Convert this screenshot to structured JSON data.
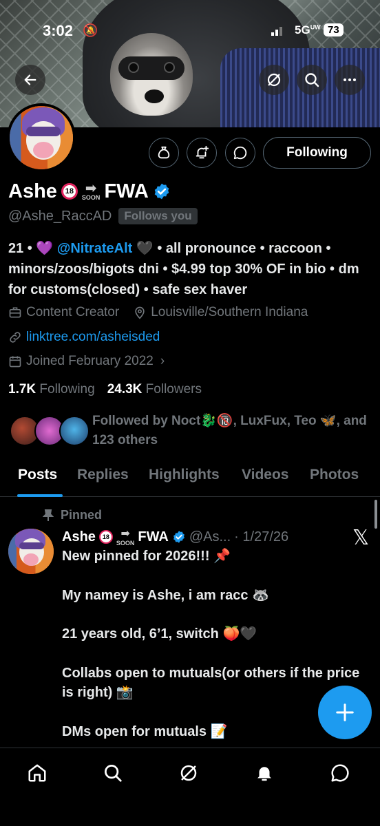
{
  "status_bar": {
    "time": "3:02",
    "network": "5G",
    "network_sub": "UW",
    "battery": "73"
  },
  "header": {
    "back_icon": "arrow-left-icon",
    "grok_icon": "grok-icon",
    "search_icon": "search-icon",
    "more_icon": "more-icon"
  },
  "profile": {
    "name": "Ashe",
    "name_badge": "18",
    "soon_label": "SOON",
    "name_suffix": "FWA",
    "handle": "@Ashe_RaccAD",
    "follows_you": "Follows you",
    "following_button": "Following",
    "bio": {
      "lead": "21 • 💜 ",
      "mention": "@NitrateAlt",
      "rest": " 🖤 • all pronounce • raccoon • minors/zoos/bigots dni • $4.99 top 30% OF in bio • dm for customs(closed) • safe sex haver"
    },
    "category": "Content Creator",
    "location": "Louisville/Southern Indiana",
    "link": "linktree.com/asheisded",
    "joined": "Joined February 2022",
    "following_count": "1.7K",
    "following_label": "Following",
    "followers_count": "24.3K",
    "followers_label": "Followers",
    "followed_by": "Followed by Noct🐉🔞, LuxFux, Teo 🦋, and 123 others"
  },
  "tabs": [
    "Posts",
    "Replies",
    "Highlights",
    "Videos",
    "Photos"
  ],
  "post": {
    "pinned_label": "Pinned",
    "author": "Ashe",
    "author_suffix": "FWA",
    "handle": "@As...",
    "date": "· 1/27/26",
    "lines": [
      "New pinned for 2026!!! 📌",
      "",
      "My namey is Ashe, i am racc 🦝",
      "",
      "21 years old, 6’1, switch 🍑🖤",
      "",
      "Collabs open to mutuals(or others if the price is right) 📸",
      "",
      "DMs open for mutuals 📝"
    ]
  },
  "bottom_nav": [
    "home-icon",
    "search-icon",
    "grok-icon",
    "notifications-icon",
    "messages-icon"
  ],
  "colors": {
    "accent": "#1d9bf0",
    "muted": "#71767b",
    "background": "#000000"
  }
}
